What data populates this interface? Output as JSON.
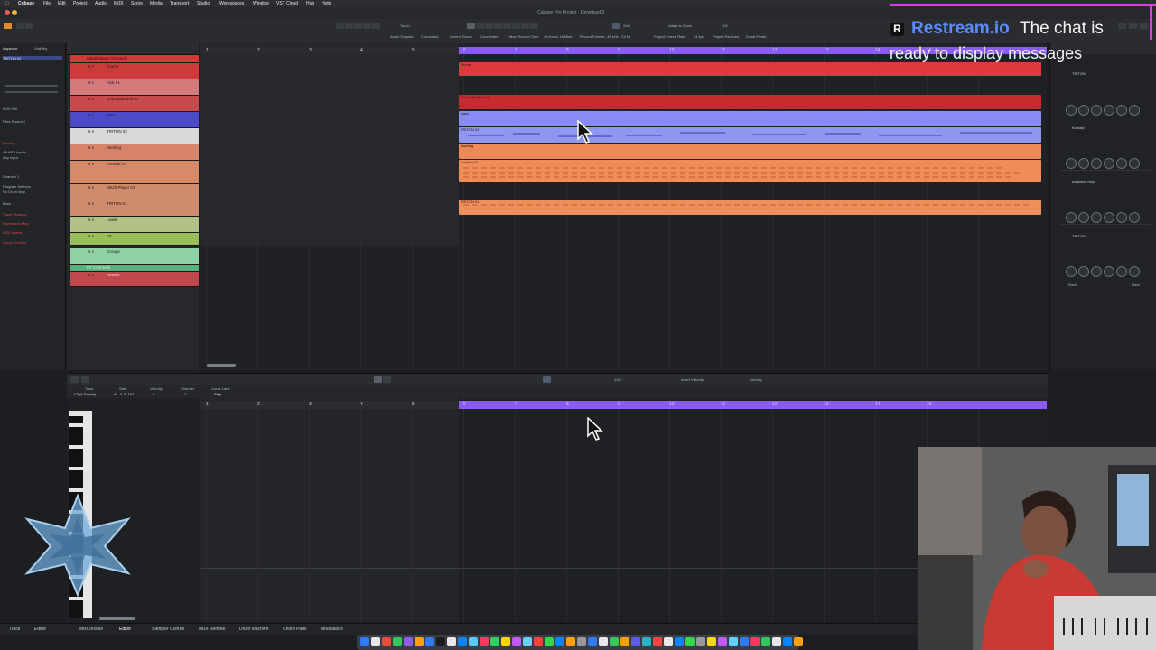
{
  "menubar": {
    "items": [
      "Cubase",
      "File",
      "Edit",
      "Project",
      "Audio",
      "MIDI",
      "Score",
      "Media",
      "Transport",
      "Studio",
      "Workspaces",
      "Window",
      "VST Cloud",
      "Hub",
      "Help"
    ]
  },
  "window_title": "Cubase Pro Project - Derwiloud 3",
  "toolbar": {
    "touch_label": "Touch",
    "grid_label": "Grid",
    "quantize_label": "1/8",
    "zoom_label": "Adapt to Zoom",
    "sub_labels": [
      "Audio Outputs",
      "Connected",
      "Control Room",
      "Connected",
      "Max. Record Time",
      "49 Hours 18 Mins",
      "Record Format - 48 kHz - 24 bit",
      "Project Frame Rate",
      "24 fps",
      "Project Pan Law",
      "Equal Power"
    ]
  },
  "inspector": {
    "track_name": "TRITON 02",
    "rows": [
      "MIDI Fail",
      "Pitch Roam/N",
      "Routing",
      "All MIDI Inputs",
      "Any Input",
      "Channel 1",
      "Program Selector",
      "No Drum Map",
      "Bass",
      "Track Versions",
      "Expression Map",
      "MIDI Inserts",
      "Quick Controls"
    ],
    "tabs": [
      "Inspector",
      "Visibility"
    ]
  },
  "tracks": [
    {
      "name": "Input/Output Channels",
      "color": "#d23a3a"
    },
    {
      "name": "Drums",
      "color": "#cc3b3b"
    },
    {
      "name": "Kick 01",
      "color": "#d47a7a"
    },
    {
      "name": "Drum Machine 01",
      "color": "#c84a4a"
    },
    {
      "name": "Bass",
      "color": "#4b4bc9"
    },
    {
      "name": "TRITON 02",
      "color": "#d9d9d9"
    },
    {
      "name": "Backing",
      "color": "#d7826b"
    },
    {
      "name": "Kontakt 07",
      "color": "#d58a68"
    },
    {
      "name": "Stitch Player 01",
      "color": "#d08b6c"
    },
    {
      "name": "TRITON 01",
      "color": "#d08b6c"
    },
    {
      "name": "Leads",
      "color": "#b2c286"
    },
    {
      "name": "FX",
      "color": "#9bbf58"
    },
    {
      "name": "Groups",
      "color": "#8fd2a5"
    },
    {
      "name": "FX Channels",
      "color": "#59b17a"
    },
    {
      "name": "Reverb",
      "color": "#c0474b"
    }
  ],
  "ruler": {
    "marks": [
      "1",
      "2",
      "3",
      "4",
      "5",
      "6",
      "7",
      "8",
      "9",
      "10",
      "11",
      "12",
      "13",
      "14",
      "15"
    ]
  },
  "parts": [
    {
      "label": "Drums",
      "color": "#e0393d"
    },
    {
      "label": "Drum Machine 01",
      "color": "#c62b2f"
    },
    {
      "label": "Bass",
      "color": "#8a8cf5"
    },
    {
      "label": "TRITON 02",
      "color": "#8f96f0"
    },
    {
      "label": "Backing",
      "color": "#ee8a57"
    },
    {
      "label": "Kontakt 07",
      "color": "#f08c58"
    },
    {
      "label": "TRITON 01",
      "color": "#ef8f5c"
    }
  ],
  "rack": {
    "slots": [
      "TRITON",
      "Kontakt",
      "Addictive Keys",
      "TRITON"
    ],
    "footer_left": "Rack",
    "footer_right": "Rack"
  },
  "editor": {
    "info_labels": [
      "Tools",
      "Start",
      "Velocity",
      "Channel",
      "Curve Lane"
    ],
    "info_values": [
      "C3 (4 Drums)",
      "44. 4. 3. 101",
      "0",
      "1",
      "Step"
    ],
    "velocity_label": "Velocity",
    "quantize_label": "1/16",
    "insert_velocity": "Insert Velocity"
  },
  "bottom_tabs": [
    "Track",
    "Editor",
    "MixConsole",
    "Editor",
    "Sampler Control",
    "MIDI Remote",
    "Drum Machine",
    "Chord Pads",
    "Modulators"
  ],
  "overlay": {
    "brand": "Restream.io",
    "message_part1": "The chat is",
    "message_part2": "ready to display messages"
  },
  "colors": {
    "accent_purple": "#8a5cf5",
    "drums_red": "#e0393d",
    "bass_blue": "#8a8cf5",
    "backing_orange": "#ee8a57"
  }
}
